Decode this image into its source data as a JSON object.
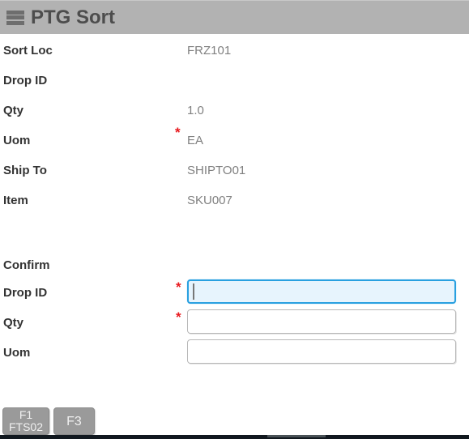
{
  "header": {
    "title": "PTG Sort",
    "menu_icon": "hamburger-menu-icon",
    "background_color": "#b2b2b2"
  },
  "info_rows": [
    {
      "label": "Sort Loc",
      "value": "FRZ101",
      "required": false
    },
    {
      "label": "Drop ID",
      "value": "",
      "required": false
    },
    {
      "label": "Qty",
      "value": "1.0",
      "required": false
    },
    {
      "label": "Uom",
      "value": "EA",
      "required": true
    },
    {
      "label": "Ship To",
      "value": "SHIPTO01",
      "required": false
    },
    {
      "label": "Item",
      "value": "SKU007",
      "required": false
    }
  ],
  "confirm": {
    "heading": "Confirm",
    "fields": [
      {
        "label": "Drop ID",
        "value": "",
        "placeholder": "",
        "required": true,
        "focused": true
      },
      {
        "label": "Qty",
        "value": "",
        "placeholder": "",
        "required": false,
        "marked": true
      },
      {
        "label": "Uom",
        "value": "",
        "placeholder": "",
        "required": false,
        "marked": false
      }
    ]
  },
  "footer": {
    "buttons": [
      {
        "key": "F1",
        "caption": "FTS02"
      },
      {
        "key": "F3",
        "caption": ""
      }
    ]
  },
  "colors": {
    "required_star": "#e8191e",
    "focus_border": "#29a0e0",
    "focus_fill": "#e7f4fd",
    "label_text": "#333333",
    "value_text": "#808080",
    "button_bg": "#9a9a9a"
  },
  "asterisk": "*"
}
